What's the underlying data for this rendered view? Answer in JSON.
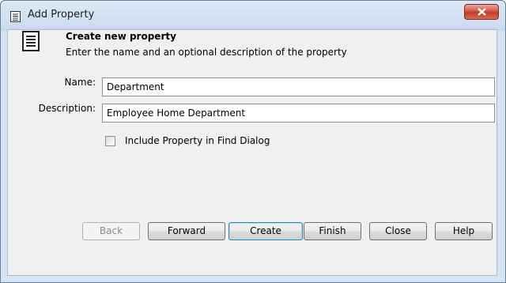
{
  "window": {
    "title": "Add Property"
  },
  "header": {
    "title": "Create new property",
    "description": "Enter the name and an optional description of the property"
  },
  "form": {
    "name_label": "Name:",
    "name_value": "Department",
    "description_label": "Description:",
    "description_value": "Employee Home Department",
    "include_find_label": "Include Property in Find Dialog",
    "include_find_checked": false
  },
  "buttons": {
    "back": "Back",
    "forward": "Forward",
    "create": "Create",
    "finish": "Finish",
    "close": "Close",
    "help": "Help"
  },
  "icons": {
    "title": "document-icon",
    "header": "document-icon",
    "close": "close-icon"
  },
  "colors": {
    "close_button": "#c9443a",
    "default_button_border": "#3c7fb1"
  }
}
